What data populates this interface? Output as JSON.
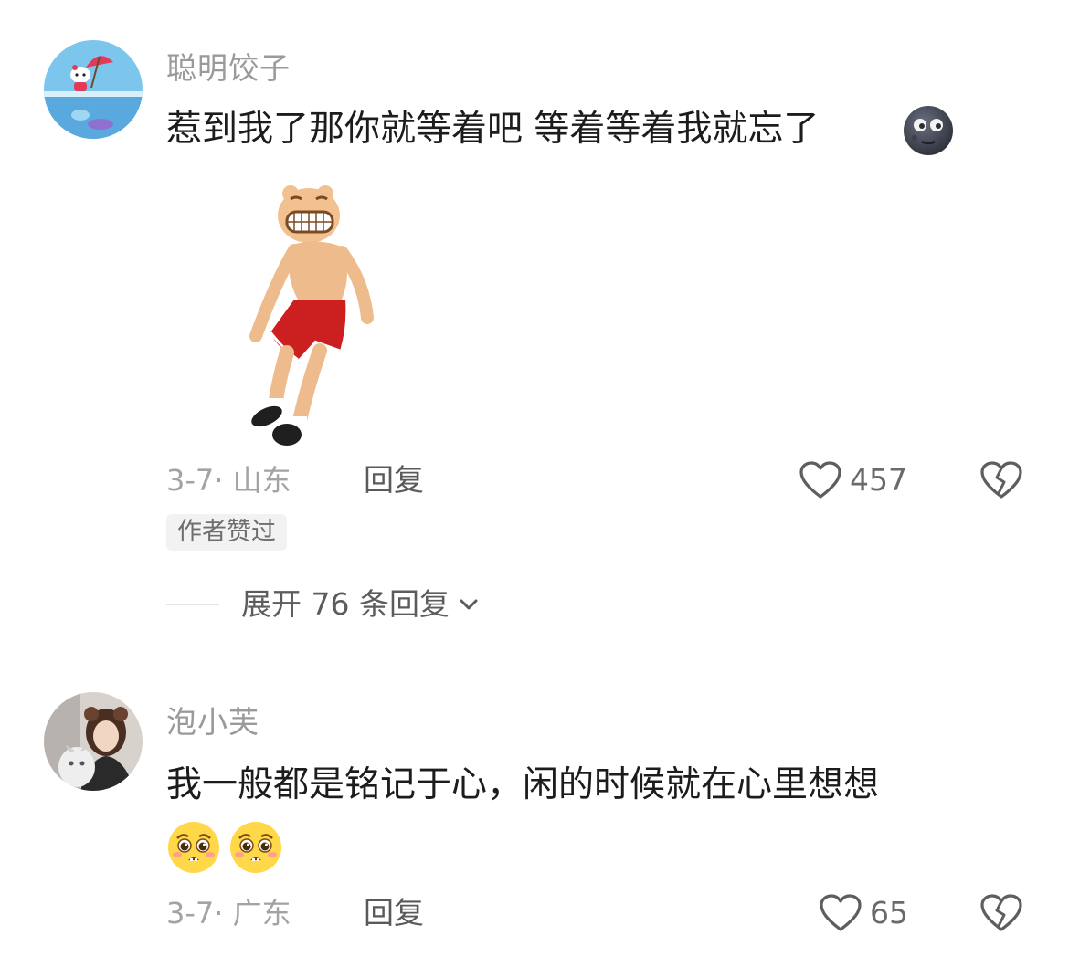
{
  "comments": [
    {
      "username": "聪明饺子",
      "text": "惹到我了那你就等着吧 等着等着我就忘了",
      "emoji": "new-moon-face-emoji",
      "sticker": "dancing-man-sticker",
      "meta": "3-7· 山东",
      "reply_label": "回复",
      "like_count": "457",
      "badge": "作者赞过",
      "expand_label": "展开 76 条回复"
    },
    {
      "username": "泡小芙",
      "text": "我一般都是铭记于心，闲的时候就在心里想想",
      "emojis": [
        "pleading-face-emoji",
        "pleading-face-emoji"
      ],
      "meta": "3-7· 广东",
      "reply_label": "回复",
      "like_count": "65"
    }
  ],
  "colors": {
    "username": "#9a9a9a",
    "text": "#1c1c1c",
    "meta": "#a3a3a3",
    "badge_bg": "#f2f2f2"
  }
}
